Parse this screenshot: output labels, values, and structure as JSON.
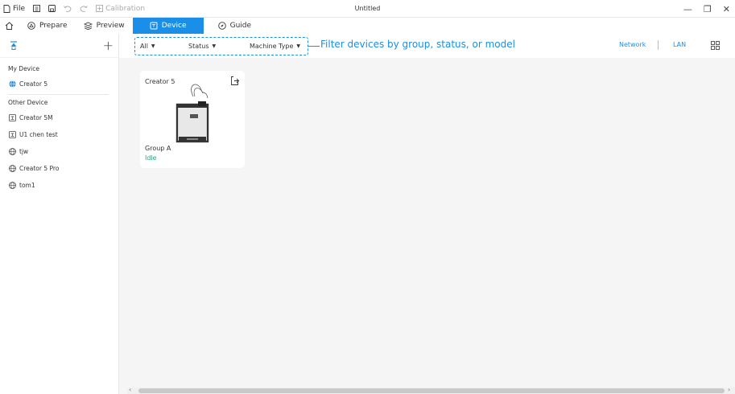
{
  "window": {
    "title": "Untitled",
    "menu": {
      "file_label": "File",
      "calibration_label": "Calibration"
    },
    "controls": {
      "minimize": "—",
      "restore": "❐",
      "close": "✕"
    }
  },
  "tabs": [
    {
      "label": "Prepare",
      "icon": "prepare-icon",
      "active": false
    },
    {
      "label": "Preview",
      "icon": "layers-icon",
      "active": false
    },
    {
      "label": "Device",
      "icon": "device-icon",
      "active": true
    },
    {
      "label": "Guide",
      "icon": "compass-icon",
      "active": false
    }
  ],
  "sidebar": {
    "my_device_label": "My Device",
    "my_devices": [
      {
        "name": "Creator 5",
        "icon": "globe-icon",
        "accent": "#1b8ee8"
      }
    ],
    "other_device_label": "Other Device",
    "other_devices": [
      {
        "name": "Creator 5M",
        "icon": "device-icon"
      },
      {
        "name": "U1 chen test",
        "icon": "device-icon"
      },
      {
        "name": "tjw",
        "icon": "globe-icon"
      },
      {
        "name": "Creator 5 Pro",
        "icon": "globe-icon"
      },
      {
        "name": "tom1",
        "icon": "globe-icon"
      }
    ]
  },
  "filters": {
    "group": "All",
    "status": "Status",
    "machine_type": "Machine Type",
    "callout": "Filter devices by group, status, or model"
  },
  "connection": {
    "network_label": "Network",
    "lan_label": "LAN"
  },
  "card": {
    "title": "Creator 5",
    "group": "Group A",
    "status": "Idle",
    "status_color": "#2aa876"
  },
  "colors": {
    "accent": "#1b8ee8",
    "background": "#f5f5f5"
  }
}
